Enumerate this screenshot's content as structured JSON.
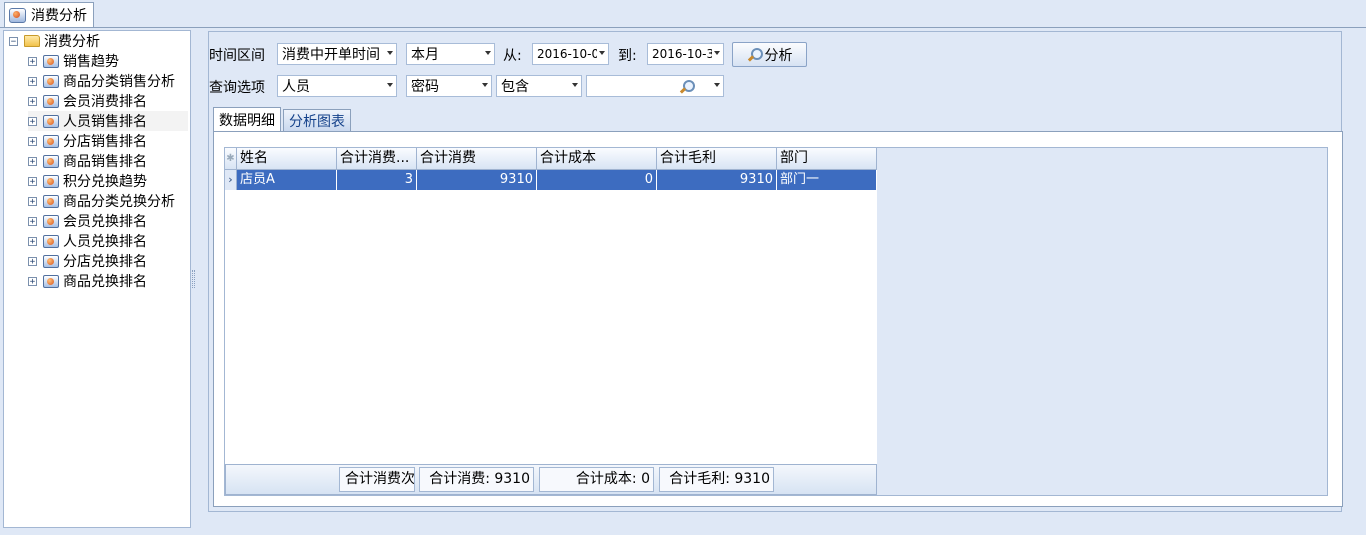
{
  "doc_tab": {
    "title": "消费分析",
    "icon": "chart-icon"
  },
  "tree": {
    "root": {
      "label": "消费分析",
      "icon": "folder-icon"
    },
    "items": [
      {
        "label": "销售趋势"
      },
      {
        "label": "商品分类销售分析"
      },
      {
        "label": "会员消费排名"
      },
      {
        "label": "人员销售排名",
        "selected": true
      },
      {
        "label": "分店销售排名"
      },
      {
        "label": "商品销售排名"
      },
      {
        "label": "积分兑换趋势"
      },
      {
        "label": "商品分类兑换分析"
      },
      {
        "label": "会员兑换排名"
      },
      {
        "label": "人员兑换排名"
      },
      {
        "label": "分店兑换排名"
      },
      {
        "label": "商品兑换排名"
      }
    ]
  },
  "filters": {
    "time_label": "时间区间",
    "time_field": "消费中开单时间",
    "period": "本月",
    "from_label": "从:",
    "from_date": "2016-10-0",
    "to_label": "到:",
    "to_date": "2016-10-3",
    "analyze_button": "分析",
    "query_label": "查询选项",
    "query_field": "人员",
    "match_field": "密码",
    "match_mode": "包含",
    "search_value": ""
  },
  "tabs": [
    {
      "label": "数据明细",
      "active": true
    },
    {
      "label": "分析图表",
      "active": false
    }
  ],
  "grid": {
    "columns": [
      "姓名",
      "合计消费...",
      "合计消费",
      "合计成本",
      "合计毛利",
      "部门"
    ],
    "rows": [
      {
        "name": "店员A",
        "count": "3",
        "consume": "9310",
        "cost": "0",
        "profit": "9310",
        "dept": "部门一"
      }
    ],
    "footer": {
      "count": "合计消费次",
      "consume": "合计消费: 9310",
      "cost": "合计成本: 0",
      "profit": "合计毛利: 9310"
    }
  },
  "colors": {
    "selection": "#3d6cc0",
    "background": "#dfe8f6",
    "border": "#8ba0bc"
  }
}
